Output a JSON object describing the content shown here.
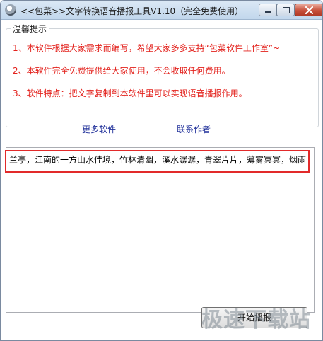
{
  "window": {
    "title": "<<包菜>>文字转换语音播报工具V1.10（完全免费使用）"
  },
  "tips": {
    "group_title": "温馨提示",
    "line1": "1、本软件根据大家需求而编写，希望大家多多支持“包菜软件工作室”~",
    "line2": "2、本软件完全免费提供给大家使用，不会收取任何费用。",
    "line3": "3、软件特点：把文字复制到本软件里可以实现语音播报作用。"
  },
  "links": {
    "more_software": "更多软件",
    "contact_author": "联系作者"
  },
  "text_input": {
    "value": "兰亭，江南的一方山水佳境，竹林清幽，溪水潺潺，青翠片片，薄雾冥冥，烟雨"
  },
  "actions": {
    "start_label": "开始播报"
  },
  "watermark": {
    "text": "极速下载站"
  },
  "icons": {
    "app": "app-icon",
    "minimize": "minimize-icon",
    "maximize": "maximize-icon",
    "close": "close-icon"
  }
}
